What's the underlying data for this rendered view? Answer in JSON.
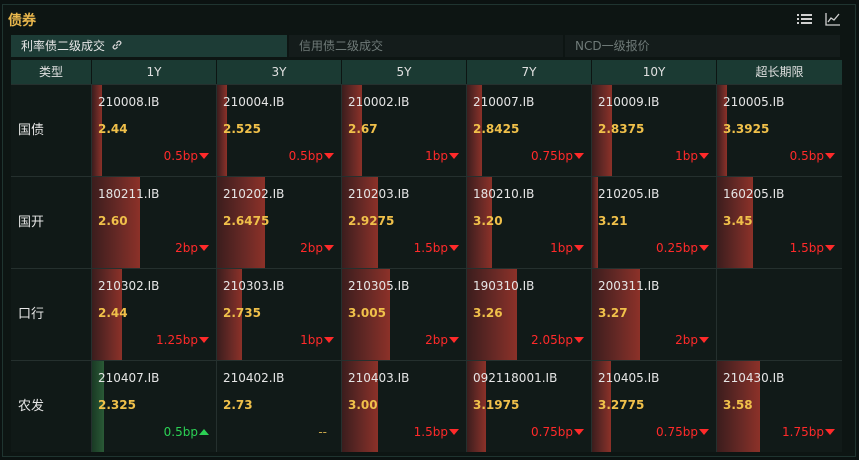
{
  "header": {
    "title": "债券",
    "icons": [
      "list-icon",
      "line-chart-icon"
    ]
  },
  "tabs": [
    {
      "label": "利率债二级成交",
      "active": true,
      "icon": "link-icon"
    },
    {
      "label": "信用债二级成交",
      "active": false
    },
    {
      "label": "NCD一级报价",
      "active": false
    }
  ],
  "columns": [
    "类型",
    "1Y",
    "3Y",
    "5Y",
    "7Y",
    "10Y",
    "超长期限"
  ],
  "colors": {
    "accent": "#e8b64c",
    "down": "#ff2a2a",
    "up": "#2bd154",
    "header_bg": "#1b3a33"
  },
  "rows": [
    {
      "label": "国债",
      "cells": [
        {
          "code": "210008.IB",
          "yield": "2.44",
          "change": "0.5bp",
          "dir": "down",
          "bar": 0.08
        },
        {
          "code": "210004.IB",
          "yield": "2.525",
          "change": "0.5bp",
          "dir": "down",
          "bar": 0.08
        },
        {
          "code": "210002.IB",
          "yield": "2.67",
          "change": "1bp",
          "dir": "down",
          "bar": 0.16
        },
        {
          "code": "210007.IB",
          "yield": "2.8425",
          "change": "0.75bp",
          "dir": "down",
          "bar": 0.12
        },
        {
          "code": "210009.IB",
          "yield": "2.8375",
          "change": "1bp",
          "dir": "down",
          "bar": 0.16
        },
        {
          "code": "210005.IB",
          "yield": "3.3925",
          "change": "0.5bp",
          "dir": "down",
          "bar": 0.08
        }
      ]
    },
    {
      "label": "国开",
      "cells": [
        {
          "code": "180211.IB",
          "yield": "2.60",
          "change": "2bp",
          "dir": "down",
          "bar": 0.39
        },
        {
          "code": "210202.IB",
          "yield": "2.6475",
          "change": "2bp",
          "dir": "down",
          "bar": 0.39
        },
        {
          "code": "210203.IB",
          "yield": "2.9275",
          "change": "1.5bp",
          "dir": "down",
          "bar": 0.29
        },
        {
          "code": "180210.IB",
          "yield": "3.20",
          "change": "1bp",
          "dir": "down",
          "bar": 0.2
        },
        {
          "code": "210205.IB",
          "yield": "3.21",
          "change": "0.25bp",
          "dir": "down",
          "bar": 0.05
        },
        {
          "code": "160205.IB",
          "yield": "3.45",
          "change": "1.5bp",
          "dir": "down",
          "bar": 0.29
        }
      ]
    },
    {
      "label": "口行",
      "cells": [
        {
          "code": "210302.IB",
          "yield": "2.44",
          "change": "1.25bp",
          "dir": "down",
          "bar": 0.24
        },
        {
          "code": "210303.IB",
          "yield": "2.735",
          "change": "1bp",
          "dir": "down",
          "bar": 0.2
        },
        {
          "code": "210305.IB",
          "yield": "3.005",
          "change": "2bp",
          "dir": "down",
          "bar": 0.39
        },
        {
          "code": "190310.IB",
          "yield": "3.26",
          "change": "2.05bp",
          "dir": "down",
          "bar": 0.4
        },
        {
          "code": "200311.IB",
          "yield": "3.27",
          "change": "2bp",
          "dir": "down",
          "bar": 0.39
        },
        {
          "code": "",
          "yield": "",
          "change": "",
          "dir": "none",
          "bar": 0
        }
      ]
    },
    {
      "label": "农发",
      "cells": [
        {
          "code": "210407.IB",
          "yield": "2.325",
          "change": "0.5bp",
          "dir": "up",
          "bar": 0.1
        },
        {
          "code": "210402.IB",
          "yield": "2.73",
          "change": "--",
          "dir": "flat",
          "bar": 0
        },
        {
          "code": "210403.IB",
          "yield": "3.00",
          "change": "1.5bp",
          "dir": "down",
          "bar": 0.29
        },
        {
          "code": "092118001.IB",
          "yield": "3.1975",
          "change": "0.75bp",
          "dir": "down",
          "bar": 0.15
        },
        {
          "code": "210405.IB",
          "yield": "3.2775",
          "change": "0.75bp",
          "dir": "down",
          "bar": 0.15
        },
        {
          "code": "210430.IB",
          "yield": "3.58",
          "change": "1.75bp",
          "dir": "down",
          "bar": 0.34
        }
      ]
    }
  ]
}
